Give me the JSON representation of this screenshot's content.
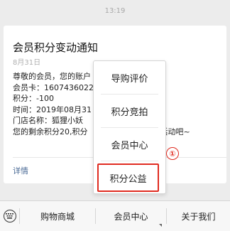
{
  "timestamp": "13:19",
  "notification": {
    "title": "会员积分变动通知",
    "date": "8月31日",
    "lines": [
      "尊敬的会员，您的账户",
      "会员卡：1607436022",
      "积分：-100",
      "时间：2019年08月31",
      "门店名称：狐狸小妖",
      "您的剩余积分20,积分"
    ],
    "line6_tail": "分活动吧~",
    "details_label": "详情"
  },
  "popup_menu": {
    "items": [
      "导购评价",
      "积分竞拍",
      "会员中心",
      "积分公益"
    ],
    "highlighted_index": 3,
    "annotation_marker": "①"
  },
  "bottom_menu": {
    "keyboard_icon": "keyboard-icon",
    "tabs": [
      "购物商城",
      "会员中心",
      "关于我们"
    ]
  },
  "colors": {
    "highlight": "#e02b20",
    "link": "#4a6a95"
  }
}
